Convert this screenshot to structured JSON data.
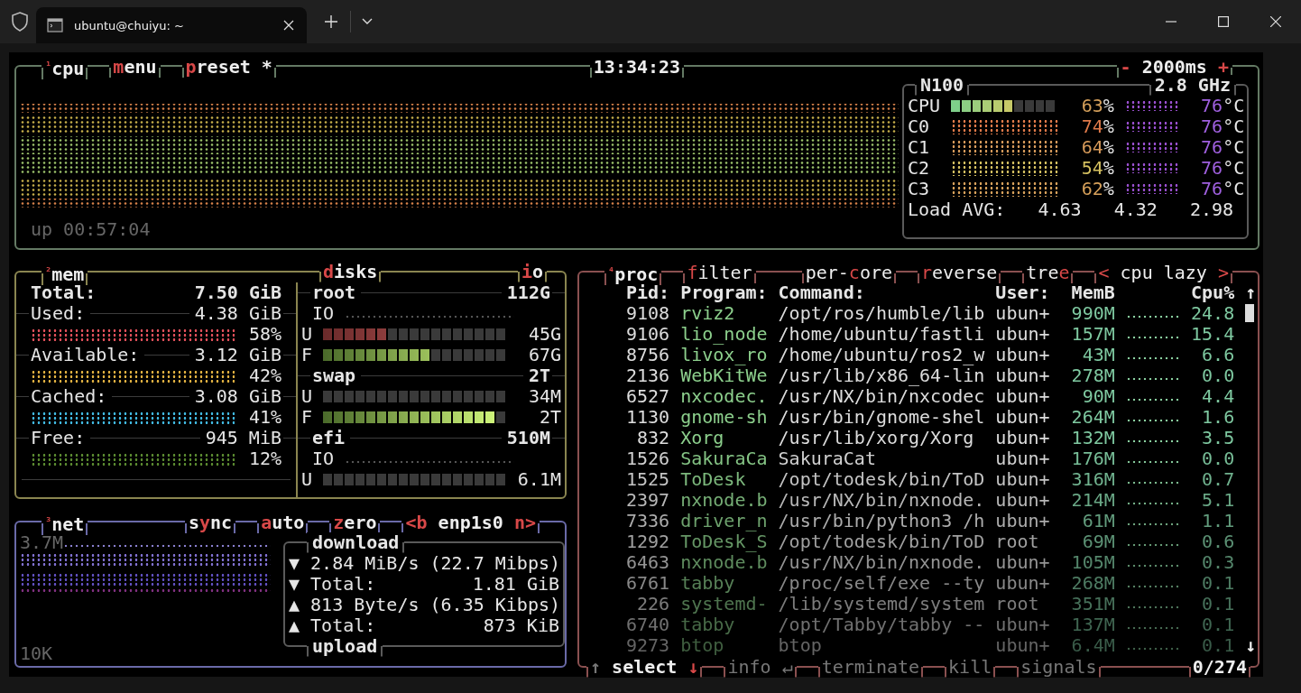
{
  "window": {
    "tab_title": "ubuntu@chuiyu: ~"
  },
  "cpu": {
    "header": {
      "left": [
        {
          "parts": [
            {
              "text": "¹",
              "kind": "sup"
            },
            {
              "text": "cpu",
              "kind": "plain"
            }
          ]
        },
        {
          "parts": [
            {
              "text": "m",
              "kind": "hot"
            },
            {
              "text": "enu",
              "kind": "plain"
            }
          ]
        },
        {
          "parts": [
            {
              "text": "p",
              "kind": "hot"
            },
            {
              "text": "reset *",
              "kind": "plain"
            }
          ]
        }
      ],
      "center": [
        {
          "parts": [
            {
              "text": "13:34:23",
              "kind": "plain"
            }
          ]
        }
      ],
      "right": [
        {
          "parts": [
            {
              "text": "-",
              "kind": "hot"
            },
            {
              "text": " 2000ms ",
              "kind": "plain"
            },
            {
              "text": "+",
              "kind": "hot"
            }
          ]
        }
      ]
    },
    "uptime": "up 00:57:04",
    "model": "N100",
    "freq": "2.8 GHz",
    "cores": [
      {
        "kind": "bar",
        "label": "CPU",
        "level": 0.63,
        "percent": "63",
        "unit": "%",
        "temp": "76",
        "temp_unit": "°C"
      },
      {
        "kind": "graph",
        "label": "C0",
        "color": "#e07a4a",
        "percent": "74",
        "unit": "%",
        "temp": "76",
        "temp_unit": "°C"
      },
      {
        "kind": "graph",
        "label": "C1",
        "color": "#d69a5a",
        "percent": "64",
        "unit": "%",
        "temp": "76",
        "temp_unit": "°C"
      },
      {
        "kind": "graph",
        "label": "C2",
        "color": "#d4c060",
        "percent": "54",
        "unit": "%",
        "temp": "76",
        "temp_unit": "°C"
      },
      {
        "kind": "graph",
        "label": "C3",
        "color": "#d6a05a",
        "percent": "62",
        "unit": "%",
        "temp": "76",
        "temp_unit": "°C"
      }
    ],
    "load": {
      "label": "Load AVG:",
      "values": [
        "4.63",
        "4.32",
        "2.98"
      ]
    }
  },
  "mem": {
    "header": {
      "left": [
        {
          "parts": [
            {
              "text": "²",
              "kind": "sup"
            },
            {
              "text": "mem",
              "kind": "plain"
            }
          ]
        }
      ]
    },
    "rows": [
      {
        "kind": "total",
        "label": "Total:",
        "value": "7.50 GiB"
      },
      {
        "kind": "stat",
        "label": "Used:",
        "value": "4.38 GiB",
        "percent": "58%",
        "color": "#e0505a"
      },
      {
        "kind": "stat",
        "label": "Available:",
        "value": "3.12 GiB",
        "percent": "42%",
        "color": "#e0b040"
      },
      {
        "kind": "stat",
        "label": "Cached:",
        "value": "3.08 GiB",
        "percent": "41%",
        "color": "#40b8e0"
      },
      {
        "kind": "stat",
        "label": "Free:",
        "value": "945 MiB",
        "percent": "12%",
        "color": "#5a8a30"
      }
    ]
  },
  "disks": {
    "header": {
      "left": [
        {
          "parts": [
            {
              "text": "d",
              "kind": "hot"
            },
            {
              "text": "isks",
              "kind": "plain"
            }
          ]
        }
      ],
      "right": [
        {
          "parts": [
            {
              "text": "i",
              "kind": "hot"
            },
            {
              "text": "o",
              "kind": "plain"
            }
          ]
        }
      ]
    },
    "items": [
      {
        "name": "root",
        "size": "112G",
        "rows": [
          {
            "kind": "io",
            "label": "IO"
          },
          {
            "kind": "used",
            "label": "U",
            "level": 0.35,
            "value": "45G"
          },
          {
            "kind": "free",
            "label": "F",
            "level": 0.59,
            "value": "67G"
          }
        ]
      },
      {
        "name": "swap",
        "size": "2T",
        "rows": [
          {
            "kind": "used",
            "label": "U",
            "value": "34M"
          },
          {
            "kind": "free",
            "label": "F",
            "level": 0.94,
            "value": "2T"
          }
        ]
      },
      {
        "name": "efi",
        "size": "510M",
        "rows": [
          {
            "kind": "io",
            "label": "IO"
          },
          {
            "kind": "used",
            "label": "U",
            "value": "6.1M"
          }
        ]
      }
    ]
  },
  "net": {
    "header": {
      "left": [
        {
          "parts": [
            {
              "text": "³",
              "kind": "sup"
            },
            {
              "text": "net",
              "kind": "plain"
            }
          ]
        }
      ],
      "right": [
        {
          "parts": [
            {
              "text": "s",
              "kind": "plain"
            },
            {
              "text": "y",
              "kind": "hot"
            },
            {
              "text": "nc",
              "kind": "plain"
            }
          ]
        },
        {
          "parts": [
            {
              "text": "a",
              "kind": "hot"
            },
            {
              "text": "uto",
              "kind": "plain"
            }
          ]
        },
        {
          "parts": [
            {
              "text": "z",
              "kind": "hot"
            },
            {
              "text": "ero",
              "kind": "plain"
            }
          ]
        },
        {
          "parts": [
            {
              "text": "<b",
              "kind": "hot"
            },
            {
              "text": " enp1s0 ",
              "kind": "plain"
            },
            {
              "text": "n>",
              "kind": "hot"
            }
          ]
        }
      ]
    },
    "max": "3.7M",
    "min": "10K",
    "download_title": "download",
    "upload_title": "upload",
    "stats": [
      {
        "arrow": "▼",
        "label": "2.84 MiB/s (22.7 Mibps)"
      },
      {
        "arrow": "▼",
        "label": "Total:",
        "value": "1.81 GiB"
      },
      {
        "arrow": "▲",
        "label": "813 Byte/s (6.35 Kibps)"
      },
      {
        "arrow": "▲",
        "label": "Total:",
        "value": "873 KiB"
      }
    ]
  },
  "proc": {
    "header": {
      "left": [
        {
          "parts": [
            {
              "text": "⁴",
              "kind": "sup"
            },
            {
              "text": "proc",
              "kind": "plain"
            }
          ]
        },
        {
          "parts": [
            {
              "text": "f",
              "kind": "hot"
            },
            {
              "text": "ilter",
              "kind": "plain"
            }
          ]
        }
      ],
      "right": [
        {
          "parts": [
            {
              "text": "per-",
              "kind": "plain"
            },
            {
              "text": "c",
              "kind": "hot"
            },
            {
              "text": "ore",
              "kind": "plain"
            }
          ]
        },
        {
          "parts": [
            {
              "text": "r",
              "kind": "hot"
            },
            {
              "text": "everse",
              "kind": "plain"
            }
          ]
        },
        {
          "parts": [
            {
              "text": "tre",
              "kind": "plain"
            },
            {
              "text": "e",
              "kind": "hot"
            }
          ]
        },
        {
          "parts": [
            {
              "text": "<",
              "kind": "hot"
            },
            {
              "text": " cpu lazy ",
              "kind": "plain"
            },
            {
              "text": ">",
              "kind": "hot"
            }
          ]
        }
      ]
    },
    "columns": [
      "Pid:",
      "Program:",
      "Command:",
      "User:",
      "MemB",
      "Cpu%"
    ],
    "scroll_up": "↑",
    "scroll_down": "↓",
    "rows": [
      [
        "9108",
        "rviz2",
        "/opt/ros/humble/lib",
        "ubun+",
        "990M",
        "24.8"
      ],
      [
        "9106",
        "lio_node",
        "/home/ubuntu/fastli",
        "ubun+",
        "157M",
        "15.4"
      ],
      [
        "8756",
        "livox_ro",
        "/home/ubuntu/ros2_w",
        "ubun+",
        "43M",
        "6.6"
      ],
      [
        "2136",
        "WebKitWe",
        "/usr/lib/x86_64-lin",
        "ubun+",
        "278M",
        "0.0"
      ],
      [
        "6527",
        "nxcodec.",
        "/usr/NX/bin/nxcodec",
        "ubun+",
        "90M",
        "4.4"
      ],
      [
        "1130",
        "gnome-sh",
        "/usr/bin/gnome-shel",
        "ubun+",
        "264M",
        "1.6"
      ],
      [
        "832",
        "Xorg",
        "/usr/lib/xorg/Xorg",
        "ubun+",
        "132M",
        "3.5"
      ],
      [
        "1526",
        "SakuraCa",
        "SakuraCat",
        "ubun+",
        "176M",
        "0.0"
      ],
      [
        "1525",
        "ToDesk",
        "/opt/todesk/bin/ToD",
        "ubun+",
        "316M",
        "0.7"
      ],
      [
        "2397",
        "nxnode.b",
        "/usr/NX/bin/nxnode.",
        "ubun+",
        "214M",
        "5.1"
      ],
      [
        "7336",
        "driver_n",
        "/usr/bin/python3 /h",
        "ubun+",
        "61M",
        "1.1"
      ],
      [
        "1292",
        "ToDesk_S",
        "/opt/todesk/bin/ToD",
        "root",
        "69M",
        "0.6"
      ],
      [
        "6463",
        "nxnode.b",
        "/usr/NX/bin/nxnode.",
        "ubun+",
        "105M",
        "0.3"
      ],
      [
        "6761",
        "tabby",
        "/proc/self/exe --ty",
        "ubun+",
        "268M",
        "0.1"
      ],
      [
        "226",
        "systemd-",
        "/lib/systemd/system",
        "root",
        "351M",
        "0.1"
      ],
      [
        "6740",
        "tabby",
        "/opt/Tabby/tabby --",
        "ubun+",
        "137M",
        "0.1"
      ],
      [
        "9273",
        "btop",
        "btop",
        "ubun+",
        "6.4M",
        "0.1"
      ]
    ],
    "footer": {
      "left": [
        {
          "bold": true,
          "parts": [
            {
              "text": "↑",
              "kind": "dim"
            },
            {
              "text": " select ",
              "kind": "plain"
            },
            {
              "text": "↓",
              "kind": "hot"
            }
          ]
        },
        {
          "parts": [
            {
              "text": "info ↵",
              "kind": "dim"
            }
          ]
        },
        {
          "parts": [
            {
              "text": "terminate",
              "kind": "dim"
            }
          ]
        },
        {
          "parts": [
            {
              "text": "kill",
              "kind": "dim"
            }
          ]
        },
        {
          "parts": [
            {
              "text": "signals",
              "kind": "dim"
            }
          ]
        }
      ],
      "right": [
        {
          "bold": true,
          "parts": [
            {
              "text": "0/274",
              "kind": "plain"
            }
          ]
        }
      ]
    }
  }
}
